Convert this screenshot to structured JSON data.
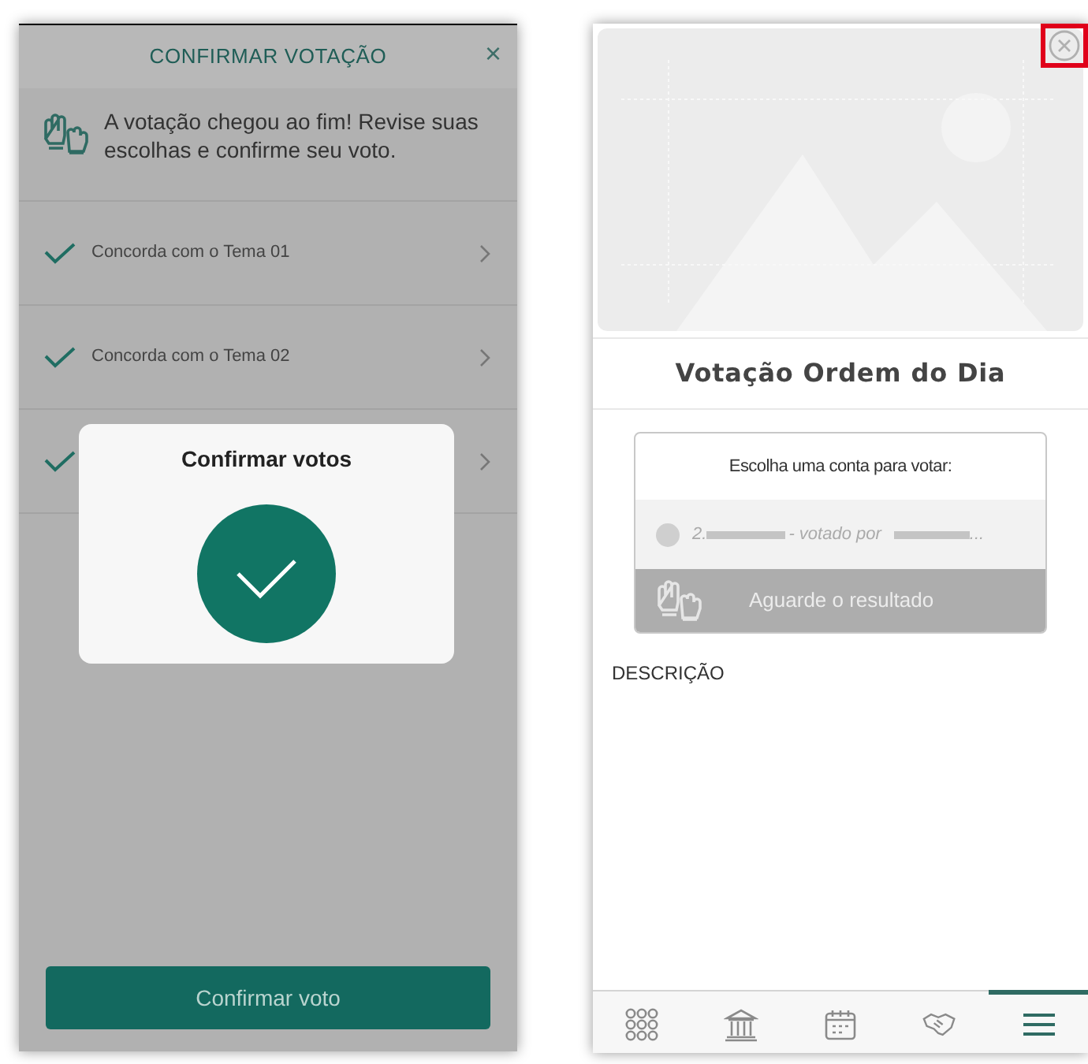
{
  "confirm_screen": {
    "title": "CONFIRMAR VOTAÇÃO",
    "close": "×",
    "intro": "A votação chegou ao fim! Revise suas escolhas e confirme seu voto.",
    "items": [
      {
        "label": "Concorda com o Tema 01",
        "checked": true
      },
      {
        "label": "Concorda com o Tema 02",
        "checked": true
      },
      {
        "checked": true
      }
    ],
    "dialog": {
      "title": "Confirmar votos"
    },
    "button": "Confirmar voto"
  },
  "detail_screen": {
    "title": "Votação Ordem do Dia",
    "account_card": {
      "heading": "Escolha uma conta para votar:",
      "account_prefix": "2.",
      "account_middle": "- votado por",
      "account_end": "...",
      "status": "Aguarde o resultado"
    },
    "description_label": "DESCRIÇÃO",
    "nav": [
      {
        "kind": "grid",
        "selected": false
      },
      {
        "kind": "bank",
        "selected": false
      },
      {
        "kind": "calendar",
        "selected": false
      },
      {
        "kind": "handshake",
        "selected": false
      },
      {
        "kind": "menu",
        "selected": true
      }
    ]
  }
}
